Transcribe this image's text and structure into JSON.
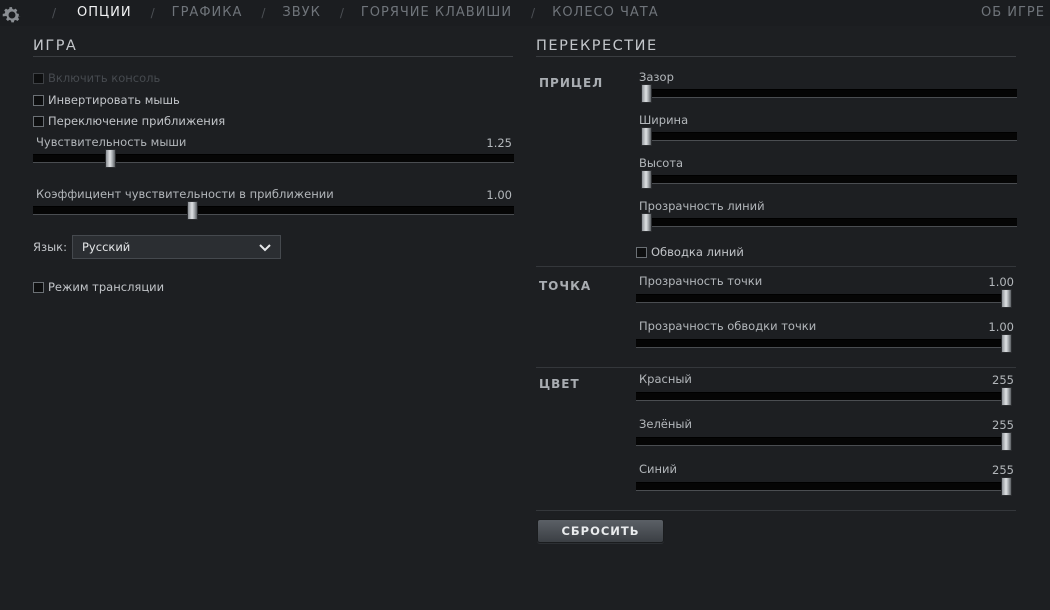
{
  "colors": {
    "background": "#1d1f22",
    "active_tab": "#f2f3f4",
    "inactive_tab": "#6f747a"
  },
  "nav": {
    "gear_icon": "gear-icon",
    "tabs": [
      {
        "label": "ОПЦИИ",
        "active": true
      },
      {
        "label": "ГРАФИКА",
        "active": false
      },
      {
        "label": "ЗВУК",
        "active": false
      },
      {
        "label": "ГОРЯЧИЕ КЛАВИШИ",
        "active": false
      },
      {
        "label": "КОЛЕСО ЧАТА",
        "active": false
      }
    ],
    "about": "ОБ ИГРЕ"
  },
  "game": {
    "title": "ИГРА",
    "console": {
      "label": "Включить консоль",
      "checked": false,
      "disabled": true
    },
    "invert_mouse": {
      "label": "Инвертировать мышь",
      "checked": false
    },
    "zoom_toggle": {
      "label": "Переключение приближения",
      "checked": false
    },
    "sensitivity": {
      "label": "Чувствительность мыши",
      "value": "1.25",
      "fraction": 0.16
    },
    "zoom_sensitivity": {
      "label": "Коэффициент чувствительности в приближении",
      "value": "1.00",
      "fraction": 0.33
    },
    "language": {
      "label": "Язык:",
      "value": "Русский",
      "icon": "chevron-down-icon"
    },
    "stream_mode": {
      "label": "Режим трансляции",
      "checked": false
    }
  },
  "crosshair": {
    "title": "ПЕРЕКРЕСТИЕ",
    "sight": {
      "label": "ПРИЦЕЛ",
      "gap": {
        "label": "Зазор",
        "fraction": 0.0
      },
      "width": {
        "label": "Ширина",
        "fraction": 0.0
      },
      "height": {
        "label": "Высота",
        "fraction": 0.0
      },
      "line_opacity": {
        "label": "Прозрачность линий",
        "fraction": 0.0
      },
      "outline": {
        "label": "Обводка линий",
        "checked": false
      }
    },
    "dot": {
      "label": "ТОЧКА",
      "opacity": {
        "label": "Прозрачность точки",
        "value": "1.00",
        "fraction": 1.0
      },
      "outline_opacity": {
        "label": "Прозрачность обводки точки",
        "value": "1.00",
        "fraction": 1.0
      }
    },
    "color": {
      "label": "ЦВЕТ",
      "red": {
        "label": "Красный",
        "value": "255",
        "fraction": 1.0
      },
      "green": {
        "label": "Зелёный",
        "value": "255",
        "fraction": 1.0
      },
      "blue": {
        "label": "Синий",
        "value": "255",
        "fraction": 1.0
      }
    },
    "reset_label": "СБРОСИТЬ"
  }
}
